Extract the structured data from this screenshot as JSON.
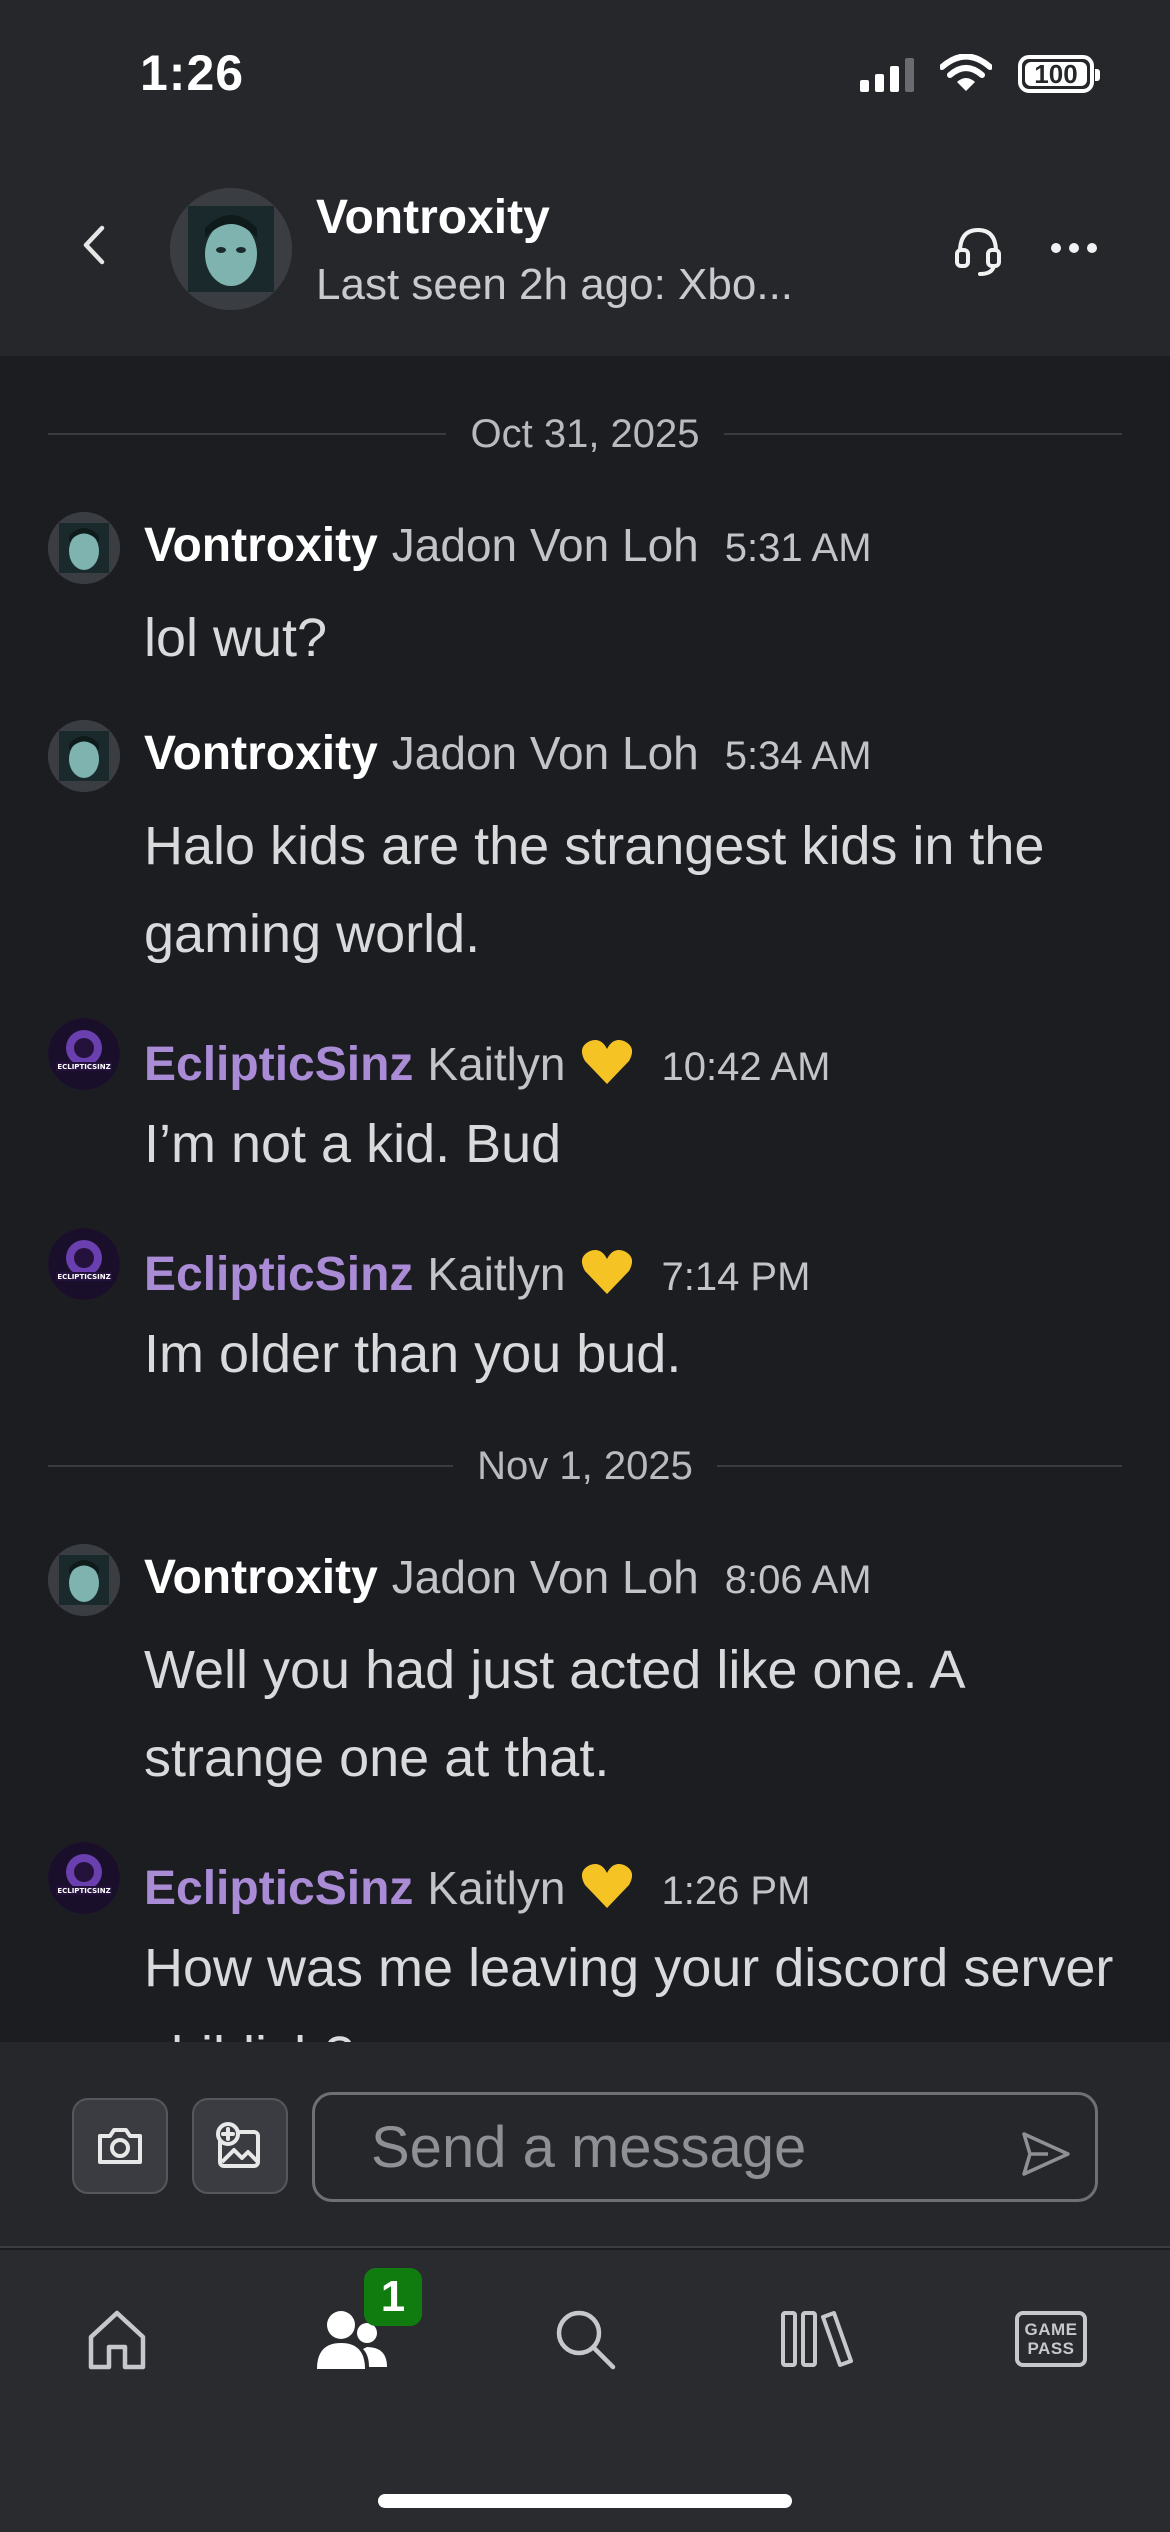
{
  "status_bar": {
    "time": "1:26",
    "battery": "100"
  },
  "header": {
    "name": "Vontroxity",
    "status": "Last seen 2h ago: Xbo..."
  },
  "chat": {
    "dividers": [
      "Oct 31, 2025",
      "Nov 1, 2025"
    ],
    "messages": [
      {
        "gamertag": "Vontroxity",
        "realname": "Jadon Von Loh",
        "time": "5:31 AM",
        "text": "lol wut?"
      },
      {
        "gamertag": "Vontroxity",
        "realname": "Jadon Von Loh",
        "time": "5:34 AM",
        "text": "Halo kids are the strangest kids in the gaming world."
      },
      {
        "gamertag": "EclipticSinz",
        "realname": "Kaitlyn",
        "time": "10:42 AM",
        "text": "I’m not a kid. Bud"
      },
      {
        "gamertag": "EclipticSinz",
        "realname": "Kaitlyn",
        "time": "7:14 PM",
        "text": "Im older than you bud."
      },
      {
        "gamertag": "Vontroxity",
        "realname": "Jadon Von Loh",
        "time": "8:06 AM",
        "text": "Well you had just acted like one. A strange one at that."
      },
      {
        "gamertag": "EclipticSinz",
        "realname": "Kaitlyn",
        "time": "1:26 PM",
        "text": "How was me leaving your discord server childish?"
      }
    ]
  },
  "composer": {
    "placeholder": "Send a message"
  },
  "nav": {
    "friends_badge": "1",
    "gamepass_line1": "GAME",
    "gamepass_line2": "PASS"
  },
  "colors": {
    "accent_purple": "#a98bd6",
    "badge_green": "#107c10",
    "heart_yellow": "#f6c325"
  },
  "icons": [
    "back-chevron-icon",
    "headset-icon",
    "more-icon",
    "camera-icon",
    "image-add-icon",
    "send-icon",
    "home-icon",
    "friends-icon",
    "search-icon",
    "library-icon",
    "gamepass-icon",
    "yellow-heart-icon"
  ]
}
